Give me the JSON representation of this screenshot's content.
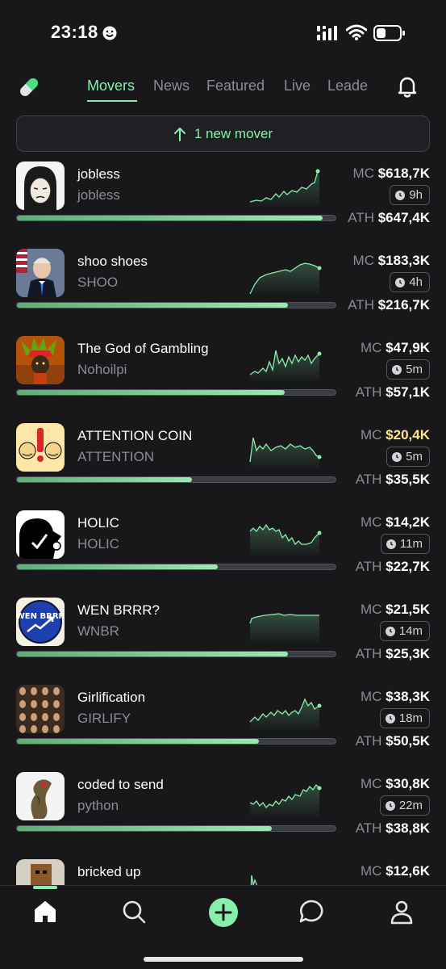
{
  "status": {
    "time": "23:18"
  },
  "tabs": [
    "Movers",
    "News",
    "Featured",
    "Live",
    "Leade"
  ],
  "banner": "1 new mover",
  "colors": {
    "accent": "#86efac",
    "highlight": "#fde68a"
  },
  "labels": {
    "mc": "MC",
    "ath": "ATH"
  },
  "coins": [
    {
      "name": "jobless",
      "ticker": "jobless",
      "mc": "$618,7K",
      "age": "9h",
      "ath": "$647,4K",
      "progress": 0.96
    },
    {
      "name": "shoo shoes",
      "ticker": "SHOO",
      "mc": "$183,3K",
      "age": "4h",
      "ath": "$216,7K",
      "progress": 0.85
    },
    {
      "name": "The God of Gambling",
      "ticker": "Nohoilpi",
      "mc": "$47,9K",
      "age": "5m",
      "ath": "$57,1K",
      "progress": 0.84
    },
    {
      "name": "ATTENTION COIN",
      "ticker": "ATTENTION",
      "mc": "$20,4K",
      "mc_highlight": true,
      "age": "5m",
      "ath": "$35,5K",
      "progress": 0.55
    },
    {
      "name": "HOLIC",
      "ticker": "HOLIC",
      "mc": "$14,2K",
      "age": "11m",
      "ath": "$22,7K",
      "progress": 0.63
    },
    {
      "name": "WEN BRRR?",
      "ticker": "WNBR",
      "mc": "$21,5K",
      "age": "14m",
      "ath": "$25,3K",
      "progress": 0.85
    },
    {
      "name": "Girlification",
      "ticker": "GIRLIFY",
      "mc": "$38,3K",
      "age": "18m",
      "ath": "$50,5K",
      "progress": 0.76
    },
    {
      "name": "coded to send",
      "ticker": "python",
      "mc": "$30,8K",
      "age": "22m",
      "ath": "$38,8K",
      "progress": 0.8
    },
    {
      "name": "bricked up",
      "ticker": "",
      "mc": "$12,6K",
      "age": "",
      "ath": "",
      "progress": 0
    }
  ],
  "avatar_text": {
    "wnbr": "WEN BRRR"
  },
  "nav": [
    "home-icon",
    "search-icon",
    "plus-icon",
    "chat-icon",
    "profile-icon"
  ]
}
